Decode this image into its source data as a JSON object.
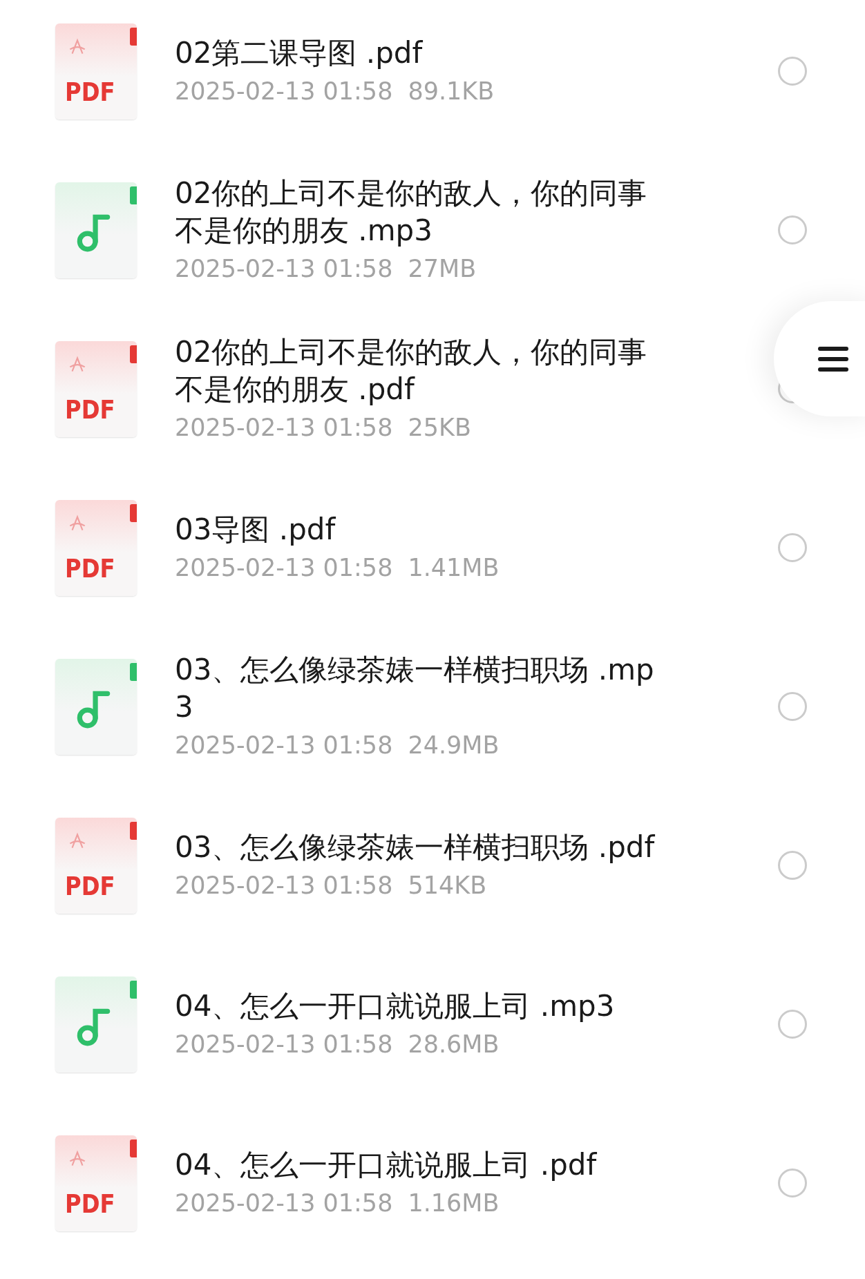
{
  "files": [
    {
      "kind": "pdf",
      "badge": "PDF",
      "name": "02第二课导图 .pdf",
      "date": "2025-02-13 01:58",
      "size": "89.1KB",
      "selected": false
    },
    {
      "kind": "audio",
      "name": "02你的上司不是你的敌人，你的同事不是你的朋友 .mp3",
      "date": "2025-02-13 01:58",
      "size": "27MB",
      "selected": false
    },
    {
      "kind": "pdf",
      "badge": "PDF",
      "name": "02你的上司不是你的敌人，你的同事不是你的朋友 .pdf",
      "date": "2025-02-13 01:58",
      "size": "25KB",
      "selected": false
    },
    {
      "kind": "pdf",
      "badge": "PDF",
      "name": "03导图 .pdf",
      "date": "2025-02-13 01:58",
      "size": "1.41MB",
      "selected": false
    },
    {
      "kind": "audio",
      "name": "03、怎么像绿茶婊一样横扫职场 .mp3",
      "date": "2025-02-13 01:58",
      "size": "24.9MB",
      "selected": false
    },
    {
      "kind": "pdf",
      "badge": "PDF",
      "name": "03、怎么像绿茶婊一样横扫职场 .pdf",
      "date": "2025-02-13 01:58",
      "size": "514KB",
      "selected": false
    },
    {
      "kind": "audio",
      "name": "04、怎么一开口就说服上司 .mp3",
      "date": "2025-02-13 01:58",
      "size": "28.6MB",
      "selected": false
    },
    {
      "kind": "pdf",
      "badge": "PDF",
      "name": "04、怎么一开口就说服上司 .pdf",
      "date": "2025-02-13 01:58",
      "size": "1.16MB",
      "selected": false
    }
  ]
}
